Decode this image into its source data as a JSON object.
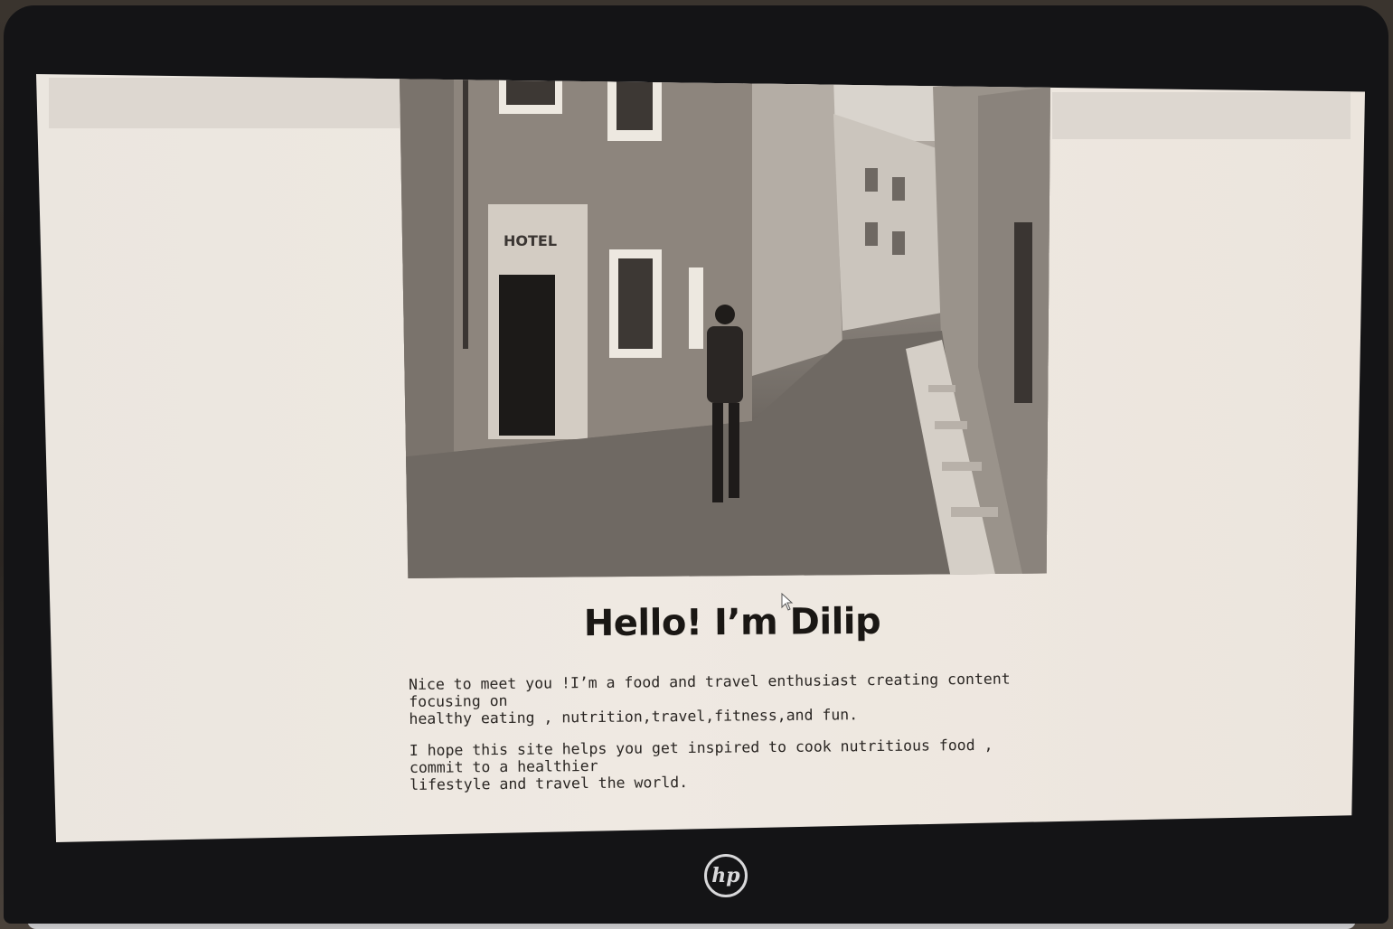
{
  "page": {
    "title": "Hello! I’m Dilip",
    "paragraphs": [
      "Nice to meet you !I’m a food and travel enthusiast creating content focusing on\nhealthy eating , nutrition,travel,fitness,and fun.",
      "I hope this site helps you get inspired to cook nutritious food , commit to a healthier\nlifestyle and travel the world."
    ],
    "hero_image": {
      "description_icon": "street-photo",
      "sign_text": "HOTEL"
    }
  },
  "device": {
    "brand_logo": "hp",
    "logo_icon": "hp-logo-icon"
  },
  "colors": {
    "page_background": "#ece6df",
    "text": "#1a1714",
    "bezel": "#141416"
  }
}
